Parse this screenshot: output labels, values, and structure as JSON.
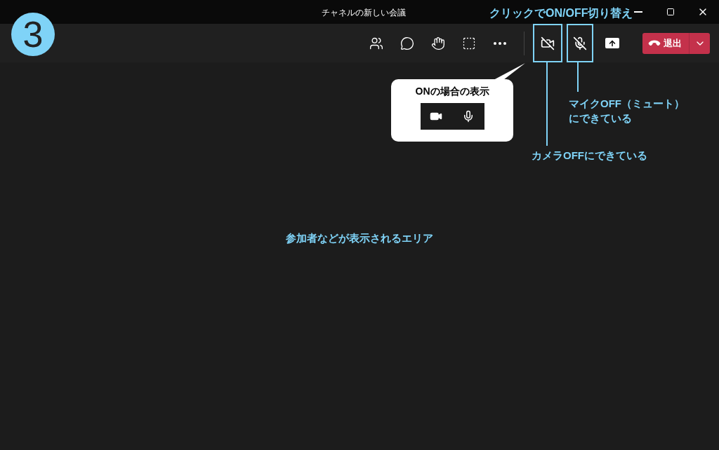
{
  "window": {
    "title": "チャネルの新しい会議"
  },
  "step_badge": "3",
  "toolbar": {
    "buttons": [
      {
        "kind": "people"
      },
      {
        "kind": "chat"
      },
      {
        "kind": "react"
      },
      {
        "kind": "rooms"
      },
      {
        "kind": "more"
      }
    ],
    "camera": {
      "on": false
    },
    "microphone": {
      "on": false
    },
    "leave": {
      "label": "退出"
    }
  },
  "annotations": {
    "toggle_note": "クリックでON/OFF切り替え",
    "callout": {
      "title": "ONの場合の表示",
      "camera": {
        "on": true
      },
      "microphone": {
        "on": true
      }
    },
    "camera_note": "カメラOFFにできている",
    "mic_note": [
      "マイクOFF（ミュート）",
      "にできている"
    ],
    "area_note": "参加者などが表示されるエリア"
  }
}
